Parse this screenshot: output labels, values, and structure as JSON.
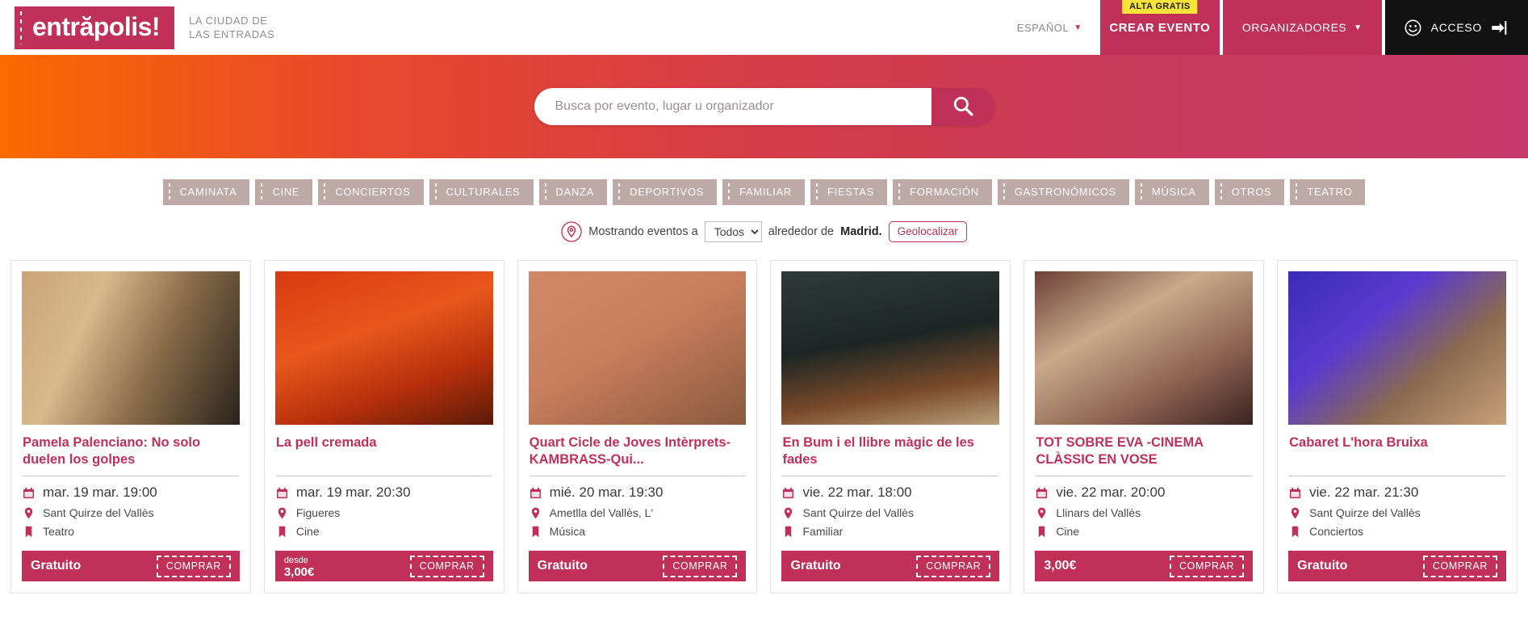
{
  "header": {
    "logo_text": "entrăpolis!",
    "tagline_line1": "LA CIUDAD DE",
    "tagline_line2": "LAS ENTRADAS",
    "language": "ESPAÑOL",
    "create_event_badge": "ALTA GRATIS",
    "create_event_label": "CREAR EVENTO",
    "organizers_label": "ORGANIZADORES",
    "access_label": "ACCESO",
    "accent_color": "#C03059",
    "access_bg_color": "#121212",
    "badge_color": "#F7E43A"
  },
  "hero": {
    "search_placeholder": "Busca por evento, lugar u organizador",
    "search_value": "",
    "gradient_from": "#F96A00",
    "gradient_to": "#C53A6B"
  },
  "categories": [
    {
      "label": "CAMINATA"
    },
    {
      "label": "CINE"
    },
    {
      "label": "CONCIERTOS"
    },
    {
      "label": "CULTURALES"
    },
    {
      "label": "DANZA"
    },
    {
      "label": "DEPORTIVOS"
    },
    {
      "label": "FAMILIAR"
    },
    {
      "label": "FIESTAS"
    },
    {
      "label": "FORMACIÓN"
    },
    {
      "label": "GASTRONÓMICOS"
    },
    {
      "label": "MÚSICA"
    },
    {
      "label": "OTROS"
    },
    {
      "label": "TEATRO"
    }
  ],
  "geobar": {
    "prefix": "Mostrando eventos a",
    "range_selected": "Todos",
    "range_options": [
      "Todos"
    ],
    "middle": "alrededor de",
    "city": "Madrid.",
    "geolocate_label": "Geolocalizar"
  },
  "events": [
    {
      "title": "Pamela Palenciano: No solo duelen los golpes",
      "date": "mar. 19 mar. 19:00",
      "place": "Sant Quirze del Vallès",
      "category": "Teatro",
      "price_label": "Gratuito",
      "price_prefix": "",
      "buy_label": "COMPRAR",
      "art_class": "art1"
    },
    {
      "title": "La pell cremada",
      "date": "mar. 19 mar. 20:30",
      "place": "Figueres",
      "category": "Cine",
      "price_label": "3,00€",
      "price_prefix": "desde",
      "buy_label": "COMPRAR",
      "art_class": "art2"
    },
    {
      "title": "Quart Cicle de Joves Intèrprets-KAMBRASS-Qui...",
      "date": "mié. 20 mar. 19:30",
      "place": "Ametlla del Vallès, L'",
      "category": "Música",
      "price_label": "Gratuito",
      "price_prefix": "",
      "buy_label": "COMPRAR",
      "art_class": "art3"
    },
    {
      "title": "En Bum i el llibre màgic de les fades",
      "date": "vie. 22 mar. 18:00",
      "place": "Sant Quirze del Vallès",
      "category": "Familiar",
      "price_label": "Gratuito",
      "price_prefix": "",
      "buy_label": "COMPRAR",
      "art_class": "art4"
    },
    {
      "title": "TOT SOBRE EVA -CINEMA CLÀSSIC EN VOSE",
      "date": "vie. 22 mar. 20:00",
      "place": "Llinars del Vallès",
      "category": "Cine",
      "price_label": "3,00€",
      "price_prefix": "",
      "buy_label": "COMPRAR",
      "art_class": "art5"
    },
    {
      "title": "Cabaret L'hora Bruixa",
      "date": "vie. 22 mar. 21:30",
      "place": "Sant Quirze del Vallès",
      "category": "Conciertos",
      "price_label": "Gratuito",
      "price_prefix": "",
      "buy_label": "COMPRAR",
      "art_class": "art6"
    }
  ],
  "icons": {
    "search": "search-icon",
    "calendar": "calendar-icon",
    "pin": "map-pin-icon",
    "bookmark": "bookmark-icon",
    "smile": "smiley-face-icon",
    "login": "login-arrow-icon",
    "chevron": "chevron-down-icon"
  }
}
